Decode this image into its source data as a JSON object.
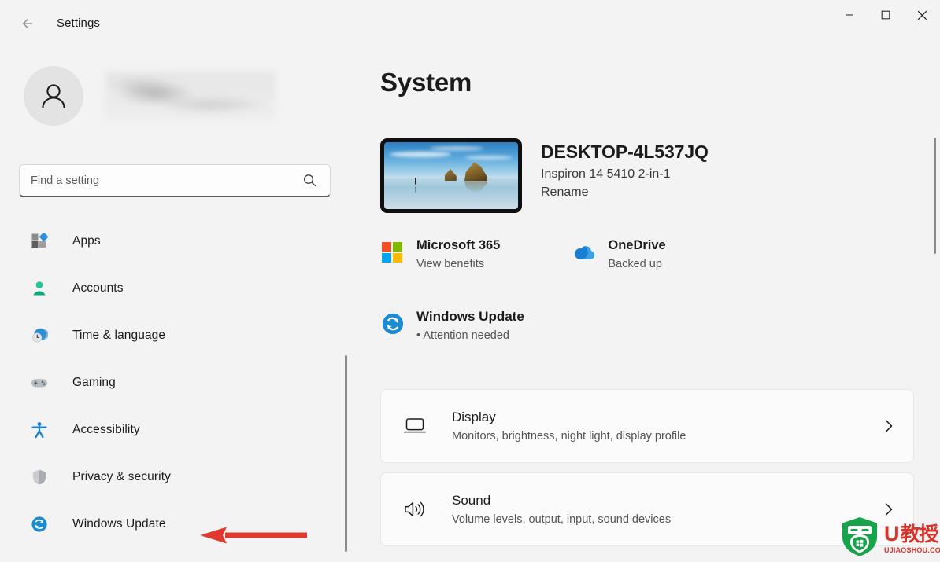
{
  "window": {
    "title": "Settings",
    "back_icon": "back-arrow-icon",
    "minimize_label": "—",
    "maximize_label": "□",
    "close_label": "✕"
  },
  "sidebar": {
    "account": {
      "avatar_icon": "person-avatar-icon",
      "name_redacted": ""
    },
    "search": {
      "placeholder": "Find a setting",
      "value": "",
      "icon": "search-icon"
    },
    "items": [
      {
        "label": "Apps",
        "icon": "apps-icon"
      },
      {
        "label": "Accounts",
        "icon": "accounts-icon"
      },
      {
        "label": "Time & language",
        "icon": "time-language-icon"
      },
      {
        "label": "Gaming",
        "icon": "gaming-icon"
      },
      {
        "label": "Accessibility",
        "icon": "accessibility-icon"
      },
      {
        "label": "Privacy & security",
        "icon": "privacy-security-icon"
      },
      {
        "label": "Windows Update",
        "icon": "windows-update-icon"
      }
    ],
    "annotation": {
      "type": "red-arrow",
      "points_to": "Windows Update",
      "color": "#e03a30"
    }
  },
  "main": {
    "page_title": "System",
    "device": {
      "thumbnail_icon": "desktop-wallpaper-thumbnail",
      "name": "DESKTOP-4L537JQ",
      "model": "Inspiron 14 5410 2-in-1",
      "rename_label": "Rename"
    },
    "services": [
      {
        "title": "Microsoft 365",
        "subtitle": "View benefits",
        "icon": "microsoft-logo-icon"
      },
      {
        "title": "OneDrive",
        "subtitle": "Backed up",
        "icon": "onedrive-cloud-icon"
      }
    ],
    "windows_update": {
      "title": "Windows Update",
      "status": "Attention needed",
      "bullet": "•",
      "icon": "windows-update-icon"
    },
    "cards": [
      {
        "title": "Display",
        "subtitle": "Monitors, brightness, night light, display profile",
        "icon": "display-monitor-icon",
        "chevron": "chevron-right-icon"
      },
      {
        "title": "Sound",
        "subtitle": "Volume levels, output, input, sound devices",
        "icon": "sound-speaker-icon",
        "chevron": "chevron-right-icon"
      }
    ]
  },
  "watermark": {
    "logo_icon": "ujiaoshou-shield-logo",
    "brand_u": "U",
    "brand_cn": "教授",
    "domain": "UJIAOSHOU.COM"
  },
  "colors": {
    "page_bg": "#f3f3f3",
    "card_bg": "#fbfbfb",
    "accent_blue": "#0078d4",
    "annotation_red": "#e03a30",
    "watermark_red": "#d6342c",
    "watermark_green": "#17a34a"
  }
}
